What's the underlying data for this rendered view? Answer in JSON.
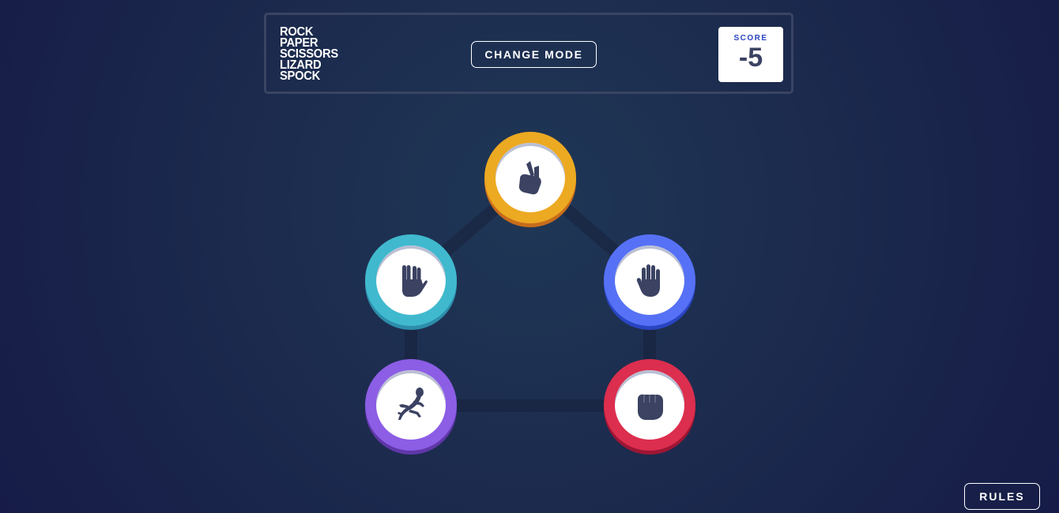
{
  "header": {
    "title_lines": [
      "ROCK",
      "PAPER",
      "SCISSORS",
      "LIZARD",
      "SPOCK"
    ],
    "change_mode_label": "CHANGE MODE",
    "score_label": "SCORE",
    "score_value": "-5"
  },
  "tokens": [
    {
      "name": "scissors",
      "color": "#eca922",
      "icon": "scissors-hand-icon"
    },
    {
      "name": "paper",
      "color": "#5671f5",
      "icon": "open-hand-icon"
    },
    {
      "name": "rock",
      "color": "#dc2e4e",
      "icon": "fist-icon"
    },
    {
      "name": "lizard",
      "color": "#8c5de5",
      "icon": "lizard-icon"
    },
    {
      "name": "spock",
      "color": "#40b9ce",
      "icon": "vulcan-salute-icon"
    }
  ],
  "footer": {
    "rules_label": "RULES"
  }
}
